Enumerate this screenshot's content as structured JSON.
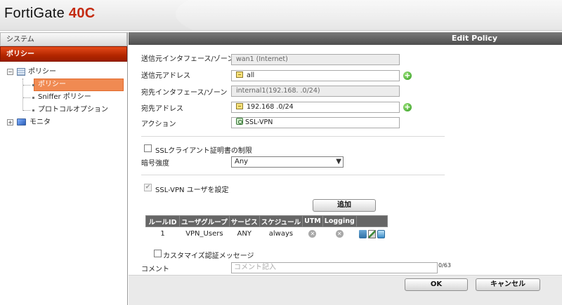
{
  "header": {
    "brand": "FortiGate",
    "model": "40C"
  },
  "sidebar": {
    "sections": [
      {
        "label": "システム"
      },
      {
        "label": "ポリシー"
      }
    ],
    "tree": {
      "root": "ポリシー",
      "children": [
        "ポリシー",
        "Sniffer ポリシー",
        "プロトコルオプション"
      ],
      "monitor": "モニタ"
    }
  },
  "panel": {
    "title": "Edit Policy"
  },
  "form": {
    "src_interface_label": "送信元インタフェース/ゾーン",
    "src_interface_value": "wan1 (Internet)",
    "src_address_label": "送信元アドレス",
    "src_address_value": "all",
    "dst_interface_label": "宛先インタフェース/ゾーン",
    "dst_interface_value": "internal1(192.168.      .0/24)",
    "dst_address_label": "宛先アドレス",
    "dst_address_value": "192.168        .0/24",
    "action_label": "アクション",
    "action_value": "SSL-VPN",
    "ssl_client_cert_label": "SSLクライアント証明書の制限",
    "cipher_label": "暗号強度",
    "cipher_value": "Any",
    "ssl_users_label": "SSL-VPN ユーザを設定",
    "add_button": "追加",
    "custom_auth_label": "カスタマイズ認証メッセージ",
    "comment_label": "コメント",
    "comment_placeholder": "コメント記入",
    "comment_counter": "0/63"
  },
  "rules_table": {
    "headers": [
      "ルールID",
      "ユーザグループ",
      "サービス",
      "スケジュール",
      "UTM",
      "Logging",
      ""
    ],
    "rows": [
      {
        "id": "1",
        "group": "VPN_Users",
        "service": "ANY",
        "schedule": "always"
      }
    ]
  },
  "buttons": {
    "ok": "OK",
    "cancel": "キャンセル"
  },
  "colors": {
    "accent": "#c42a10",
    "active_section": "#b32600",
    "selected_item": "#f08a52",
    "panel_header": "#5a5a5a"
  }
}
